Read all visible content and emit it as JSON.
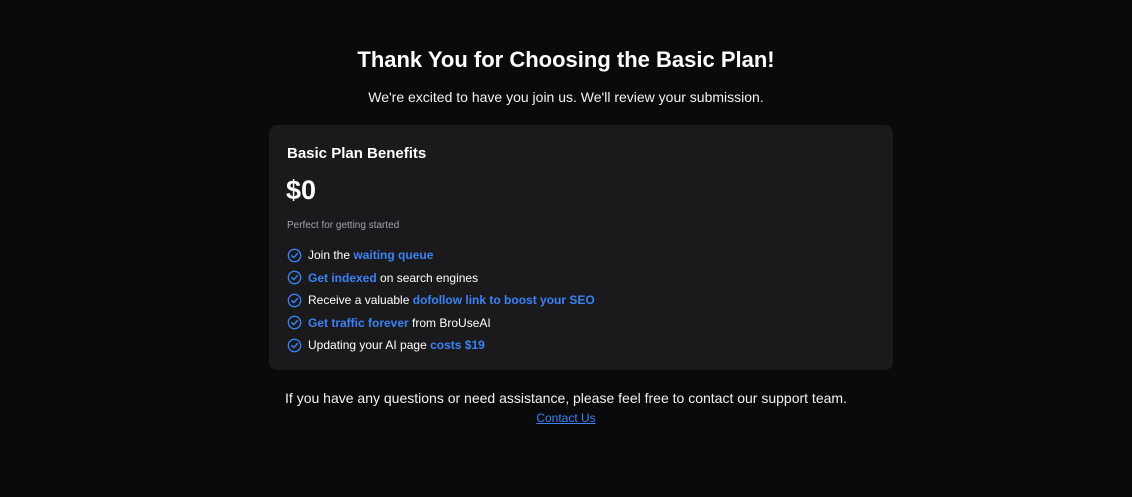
{
  "header": {
    "title": "Thank You for Choosing the Basic Plan!",
    "subtitle": "We're excited to have you join us. We'll review your submission."
  },
  "card": {
    "heading": "Basic Plan Benefits",
    "price": "$0",
    "tagline": "Perfect for getting started",
    "benefits": [
      {
        "before": "Join the ",
        "highlight": "waiting queue",
        "after": ""
      },
      {
        "before": "",
        "highlight": "Get indexed",
        "after": " on search engines"
      },
      {
        "before": "Receive a valuable ",
        "highlight": "dofollow link to boost your SEO",
        "after": ""
      },
      {
        "before": "",
        "highlight": "Get traffic forever",
        "after": " from BroUseAI"
      },
      {
        "before": "Updating your AI page ",
        "highlight": "costs $19",
        "after": ""
      }
    ],
    "icon": "check-circle-icon"
  },
  "footer": {
    "text": "If you have any questions or need assistance, please feel free to contact our support team.",
    "link_label": "Contact Us"
  },
  "colors": {
    "background": "#0a0a0c",
    "card": "#1a1a1d",
    "accent": "#3b82f6"
  }
}
